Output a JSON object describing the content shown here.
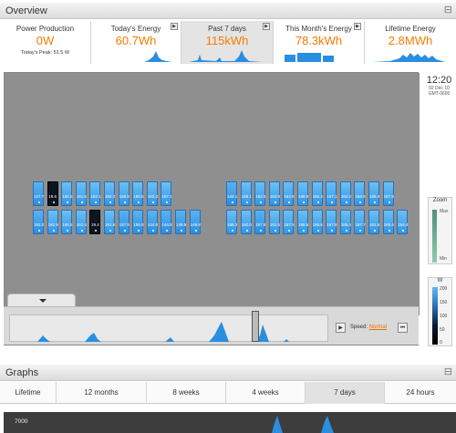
{
  "overview": {
    "title": "Overview"
  },
  "cards": [
    {
      "title": "Power Production",
      "value": "0W",
      "subtitle": "Today's Peak: 51.5 W",
      "active": false,
      "play": false
    },
    {
      "title": "Today's Energy",
      "value": "60.7Wh",
      "active": false,
      "play": true
    },
    {
      "title": "Past 7 days",
      "value": "115kWh",
      "active": true,
      "play": true
    },
    {
      "title": "This Month's Energy",
      "value": "78.3kWh",
      "active": false,
      "play": true
    },
    {
      "title": "Lifetime Energy",
      "value": "2.8MWh",
      "active": false,
      "play": false
    }
  ],
  "clock": {
    "time": "12:20",
    "date": "02 Dec 10",
    "tz": "GMT-0600"
  },
  "zoom": {
    "label": "Zoom",
    "max": "Max",
    "min": "Min"
  },
  "legend": {
    "unit": "W",
    "ticks": [
      "200",
      "150",
      "100",
      "50",
      "0"
    ]
  },
  "timeline": {
    "speed_label": "Speed:",
    "speed_value": "Normal"
  },
  "array": {
    "group1_row1": [
      "127.7",
      "18.6",
      "165.5",
      "161.6",
      "182.1",
      "162.3",
      "166.6",
      "165.5",
      "162.3",
      "167.1"
    ],
    "group1_row2": [
      "152.0",
      "162.9",
      "165.5",
      "161.4",
      "19.4",
      "161.6",
      "157.5",
      "155.8",
      "144.8",
      "144.8",
      "149.8",
      "149.8"
    ],
    "group2_row1": [
      "145.1",
      "168.1",
      "162.6",
      "163.8",
      "164.9",
      "166.9",
      "165.4",
      "167.1",
      "164.3",
      "168.9",
      "165.4",
      "167.8"
    ],
    "group2_row2": [
      "165.3",
      "162.0",
      "157.8",
      "161.5",
      "167.5",
      "166.5",
      "165.6",
      "167.8",
      "165.4",
      "167.7",
      "161.6",
      "165.4",
      "164.4"
    ]
  },
  "graphs": {
    "title": "Graphs",
    "ytick": "7000"
  },
  "ranges": [
    {
      "label": "Lifetime",
      "active": false
    },
    {
      "label": "12 months",
      "active": false
    },
    {
      "label": "8 weeks",
      "active": false
    },
    {
      "label": "4 weeks",
      "active": false
    },
    {
      "label": "7 days",
      "active": true
    },
    {
      "label": "24 hours",
      "active": false
    }
  ],
  "colors": {
    "accent": "#f57c00",
    "panel": "#2a8ee0",
    "panel_dark": "#0b1622"
  }
}
